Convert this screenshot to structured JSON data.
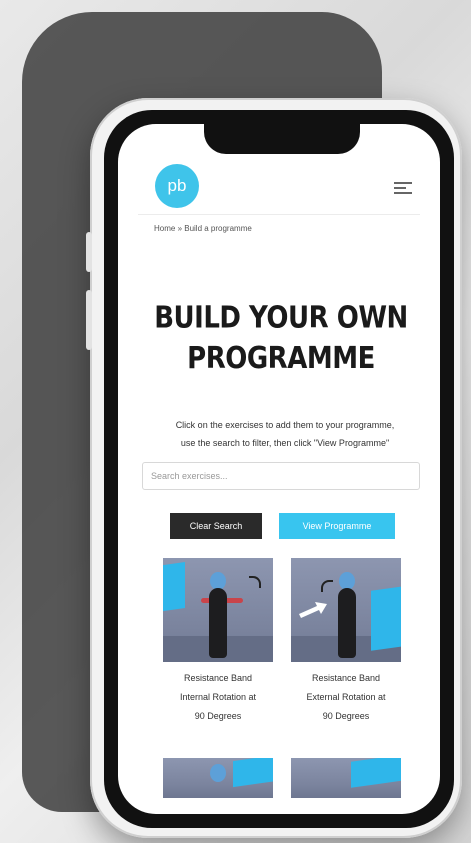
{
  "header": {
    "logo_text": "pb",
    "menu_icon": "hamburger-menu-icon"
  },
  "breadcrumb": "Home » Build a programme",
  "page": {
    "title_line1": "BUILD YOUR OWN",
    "title_line2": "PROGRAMME",
    "intro_line1": "Click on the exercises to add them to your programme,",
    "intro_line2": "use the search to filter, then click \"View Programme\""
  },
  "search": {
    "placeholder": "Search exercises...",
    "value": ""
  },
  "buttons": {
    "clear_label": "Clear Search",
    "view_label": "View Programme"
  },
  "exercises": [
    {
      "label_line1": "Resistance Band",
      "label_line2": "Internal Rotation at",
      "label_line3": "90 Degrees"
    },
    {
      "label_line1": "Resistance Band",
      "label_line2": "External Rotation at",
      "label_line3": "90 Degrees"
    }
  ],
  "colors": {
    "accent": "#38c5ef",
    "dark_button": "#2a2a2a",
    "thumbnail_bg": "#7a839d"
  }
}
